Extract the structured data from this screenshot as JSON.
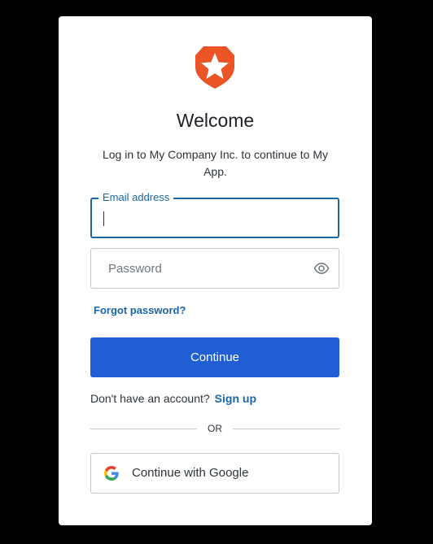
{
  "brand": {
    "logo_icon": "auth0-shield-star-icon",
    "logo_color": "#eb5424",
    "primary_color": "#1f5fd3",
    "link_color": "#1a66a9"
  },
  "header": {
    "title": "Welcome",
    "subtitle": "Log in to My Company Inc. to continue to My App."
  },
  "form": {
    "email": {
      "label": "Email address",
      "value": ""
    },
    "password": {
      "placeholder": "Password",
      "value": "",
      "toggle_icon": "eye-icon"
    },
    "forgot_password": "Forgot password?",
    "continue_label": "Continue"
  },
  "signup": {
    "prompt": "Don't have an account?",
    "link": "Sign up"
  },
  "divider": {
    "text": "OR"
  },
  "social": {
    "google_label": "Continue with Google",
    "google_icon": "google-g-icon"
  }
}
